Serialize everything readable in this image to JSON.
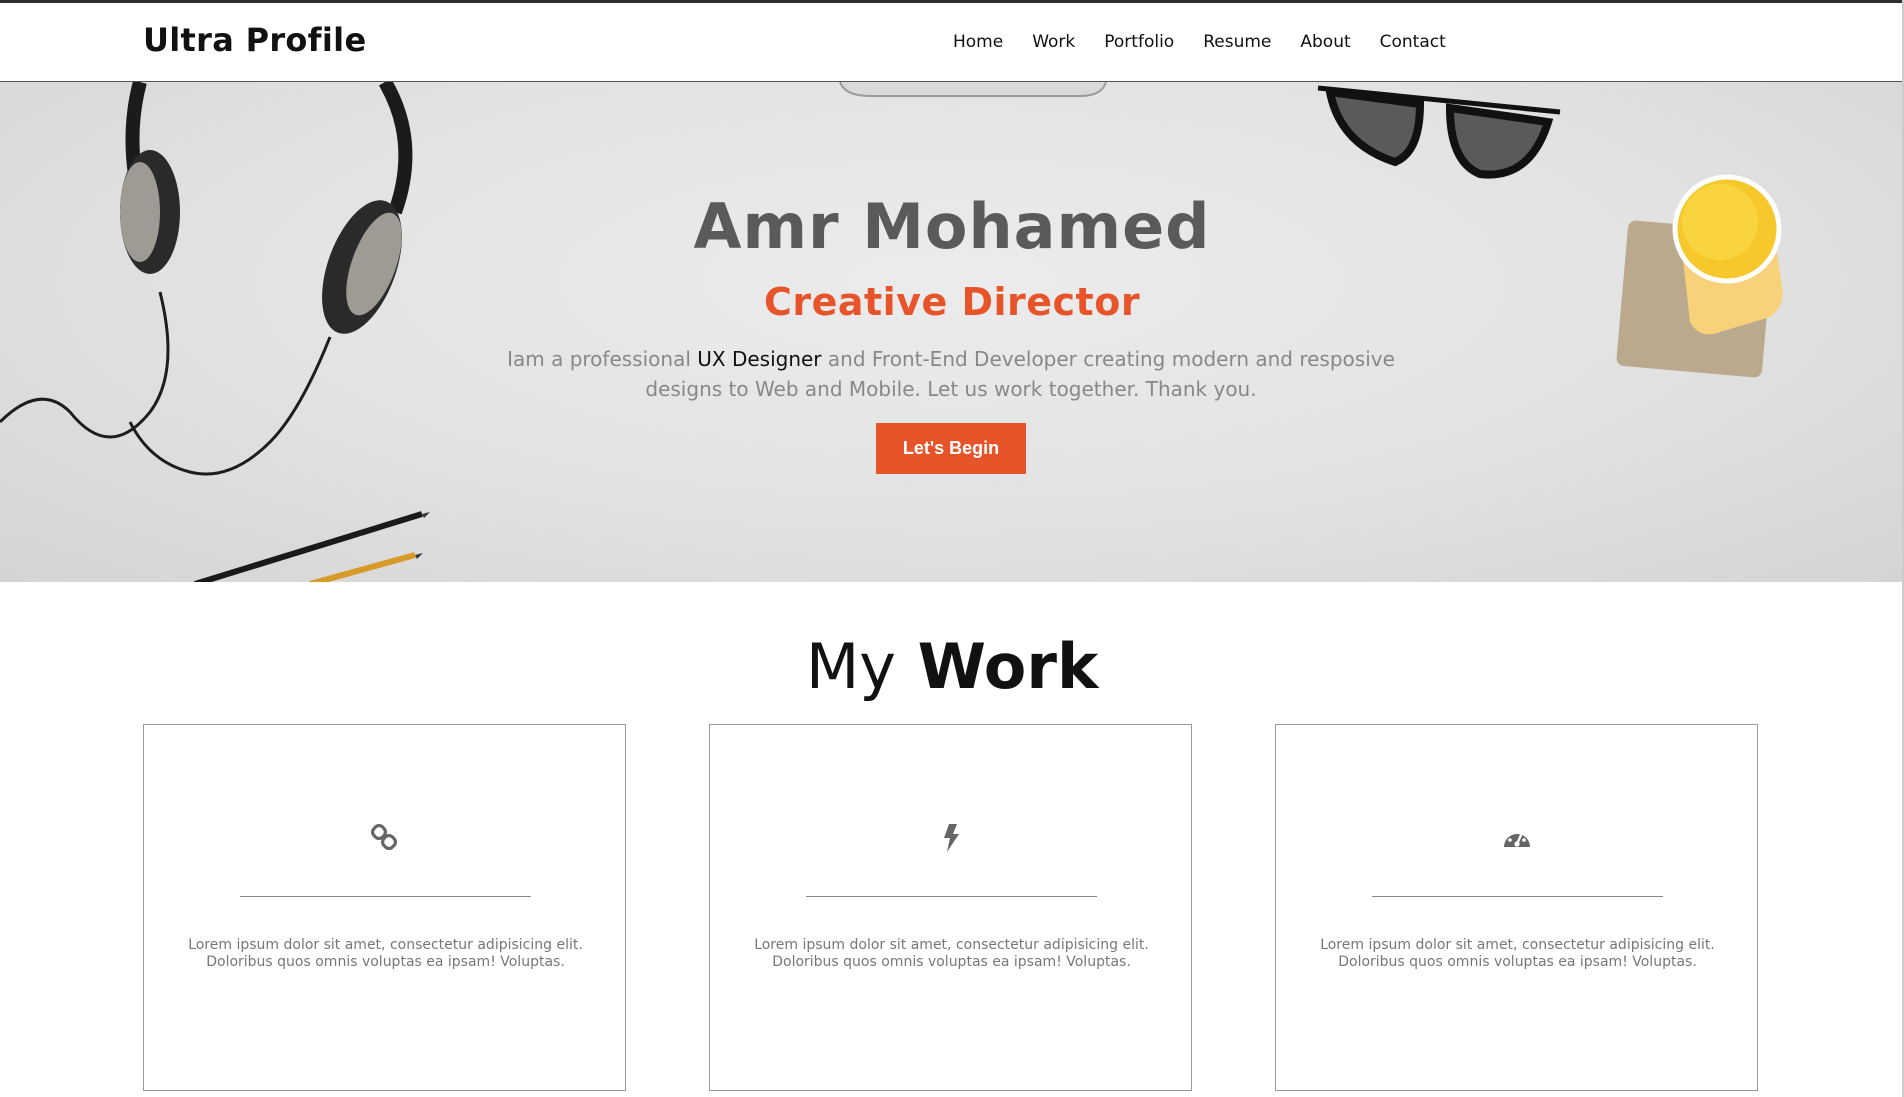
{
  "brand": "Ultra Profile",
  "nav": {
    "home": "Home",
    "work": "Work",
    "portfolio": "Portfolio",
    "resume": "Resume",
    "about": "About",
    "contact": "Contact"
  },
  "hero": {
    "name": "Amr Mohamed",
    "role": "Creative Director",
    "desc_before": "Iam a professional ",
    "desc_highlight": "UX Designer",
    "desc_after": " and Front-End Developer creating modern and resposive designs to Web and Mobile. Let us work together. Thank you.",
    "cta_label": "Let's Begin"
  },
  "work": {
    "title_light": "My",
    "title_bold": "Work",
    "cards": [
      {
        "icon": "link-icon",
        "text": "Lorem ipsum dolor sit amet, consectetur adipisicing elit. Doloribus quos omnis voluptas ea ipsam! Voluptas."
      },
      {
        "icon": "bolt-icon",
        "text": "Lorem ipsum dolor sit amet, consectetur adipisicing elit. Doloribus quos omnis voluptas ea ipsam! Voluptas."
      },
      {
        "icon": "dashboard-icon",
        "text": "Lorem ipsum dolor sit amet, consectetur adipisicing elit. Doloribus quos omnis voluptas ea ipsam! Voluptas."
      }
    ]
  },
  "colors": {
    "accent": "#e8542a",
    "hero_title": "#5a5a5a",
    "text_muted": "#888888"
  }
}
